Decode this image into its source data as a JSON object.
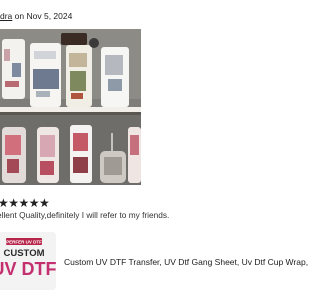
{
  "review": {
    "reviewer_name": "dra",
    "on_word": " on ",
    "date": "Nov 5, 2024",
    "rating": 5,
    "stars_text": "★★★★★",
    "text": "ellent Quality,definitely I will refer to my friends."
  },
  "item": {
    "thumb_banner": "PERFER UV DTF",
    "thumb_word_1": "CUSTOM",
    "thumb_word_2": "UV DTF",
    "title": "Custom UV DTF Transfer, UV Dtf Gang Sheet, Uv Dtf Cup Wrap,"
  },
  "colors": {
    "thumb_word_2": "#c4306f",
    "thumb_banner": "#b8254a",
    "star": "#222222"
  }
}
